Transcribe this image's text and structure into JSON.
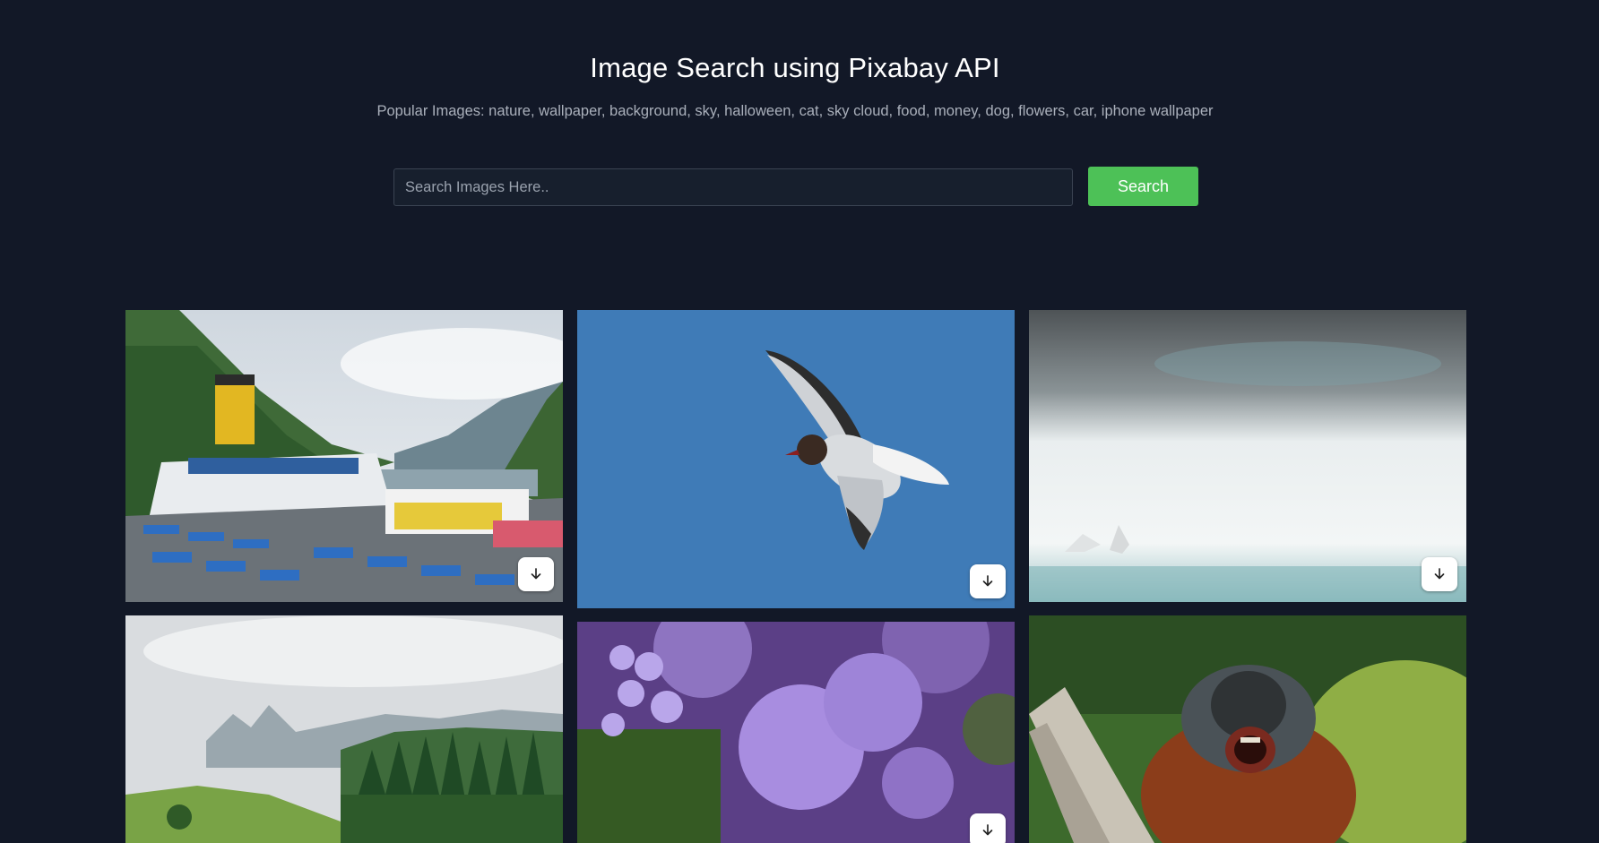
{
  "header": {
    "title": "Image Search using Pixabay API",
    "popular": "Popular Images: nature, wallpaper, background, sky, halloween, cat, sky cloud, food, money, dog, flowers, car, iphone wallpaper"
  },
  "search": {
    "placeholder": "Search Images Here..",
    "value": "",
    "button_label": "Search"
  },
  "gallery": {
    "items": [
      {
        "subject": "cruise ship deck in fjord",
        "icon": "download-icon"
      },
      {
        "subject": "gull flying in blue sky",
        "icon": "download-icon"
      },
      {
        "subject": "misty sea with birds",
        "icon": "download-icon"
      },
      {
        "subject": "green hills and forest with clouds",
        "icon": "download-icon"
      },
      {
        "subject": "purple ageratum flowers",
        "icon": "download-icon"
      },
      {
        "subject": "orangutan in grass",
        "icon": "download-icon"
      }
    ]
  },
  "colors": {
    "background": "#121827",
    "accent": "#4dc157"
  }
}
